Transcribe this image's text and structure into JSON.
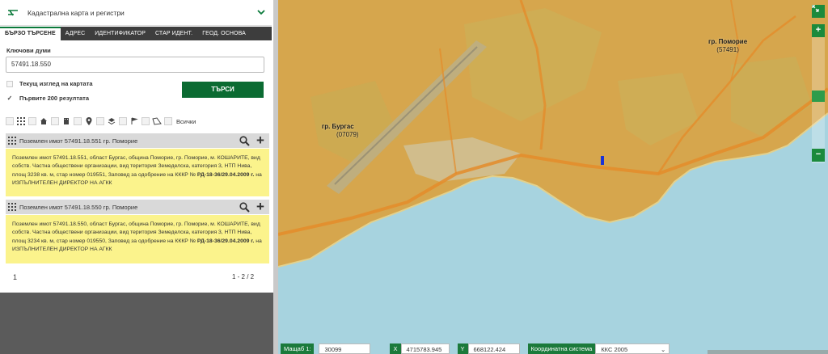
{
  "header": {
    "title": "Кадастрална карта и регистри"
  },
  "tabs": [
    {
      "label": "БЪРЗО ТЪРСЕНЕ"
    },
    {
      "label": "АДРЕС"
    },
    {
      "label": "ИДЕНТИФИКАТОР"
    },
    {
      "label": "СТАР ИДЕНТ."
    },
    {
      "label": "ГЕОД. ОСНОВА"
    }
  ],
  "search": {
    "keywords_label": "Ключови думи",
    "keywords_value": "57491.18.550",
    "current_view_label": "Текущ изглед на картата",
    "current_view_checked": false,
    "first200_label": "Първите 200 резултата",
    "first200_checked": true,
    "button_label": "ТЪРСИ"
  },
  "filters": {
    "all_label": "Всички"
  },
  "results": [
    {
      "title": "Поземлен имот 57491.18.551 гр. Поморие",
      "text_1": "Поземлен имот 57491.18.551, област Бургас, община Поморие, гр. Поморие, м. КОШАРИТЕ, вид собств. Частна общ­ествени организации, вид територия Земеделска, категория 3, НТП Нива, площ 3238 кв. м, стар номер 019551, Заповед за одобрение на КККР №",
      "order": "РД-18-36/29.04.2009 г.",
      "text_2": "на ИЗПЪЛНИТЕЛЕН ДИРЕКТОР НА АГКК"
    },
    {
      "title": "Поземлен имот 57491.18.550 гр. Поморие",
      "text_1": "Поземлен имот 57491.18.550, област Бургас, община Поморие, гр. Поморие, м. КОШАРИТЕ, вид собств. Частна обществени организации, вид територия Земеделска, категория 3, НТП Нива, площ 3234 кв. м, стар номер 019550, Заповед за одобрение на КККР №",
      "order": "РД-18-36/29.04.2009 г.",
      "text_2": "на ИЗПЪЛНИТЕЛЕН ДИРЕКТОР НА АГКК"
    }
  ],
  "pager": {
    "page": "1",
    "count": "1 - 2 / 2"
  },
  "map": {
    "labels": [
      {
        "name": "гр. Бургас",
        "code": "(07079)"
      },
      {
        "name": "гр. Поморие",
        "code": "(57491)"
      }
    ],
    "zoom_in": "+",
    "zoom_out": "−"
  },
  "bottombar": {
    "scale_label": "Мащаб 1:",
    "scale_value": "30099",
    "x_label": "X",
    "x_value": "4715783.945",
    "y_label": "Y",
    "y_value": "668122.424",
    "crs_label": "Координатна система",
    "crs_value": "ККС 2005"
  },
  "colors": {
    "accent": "#0b6b32",
    "sea": "#a7d3df",
    "land": "#d9a84e",
    "highlight": "#fbf38c"
  }
}
